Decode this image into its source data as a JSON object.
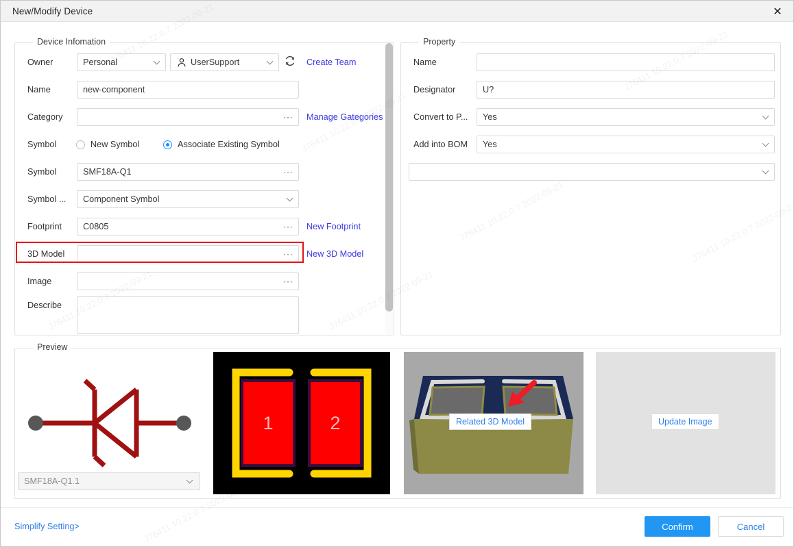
{
  "window": {
    "title": "New/Modify Device",
    "close_icon": "close-icon"
  },
  "device_information": {
    "legend": "Device Infomation",
    "owner": {
      "label": "Owner",
      "scope_value": "Personal",
      "team_value": "UserSupport",
      "team_icon": "person-icon",
      "refresh_icon": "refresh-icon",
      "create_team_link": "Create Team"
    },
    "name": {
      "label": "Name",
      "value": "new-component"
    },
    "category": {
      "label": "Category",
      "value": "",
      "browse_icon": "ellipsis-icon",
      "link": "Manage Gategories"
    },
    "symbol_mode": {
      "label": "Symbol",
      "option_new": "New Symbol",
      "option_existing": "Associate Existing Symbol",
      "selected": "Associate Existing Symbol"
    },
    "symbol": {
      "label": "Symbol",
      "value": "SMF18A-Q1",
      "browse_icon": "ellipsis-icon"
    },
    "symbol_type": {
      "label": "Symbol ...",
      "value": "Component Symbol"
    },
    "footprint": {
      "label": "Footprint",
      "value": "C0805",
      "browse_icon": "ellipsis-icon",
      "link": "New Footprint"
    },
    "model_3d": {
      "label": "3D Model",
      "value": "",
      "browse_icon": "ellipsis-icon",
      "link": "New 3D Model",
      "highlighted": true
    },
    "image": {
      "label": "Image",
      "value": "",
      "browse_icon": "ellipsis-icon"
    },
    "describe": {
      "label": "Describe",
      "value": ""
    }
  },
  "property": {
    "legend": "Property",
    "name": {
      "label": "Name",
      "value": ""
    },
    "designator": {
      "label": "Designator",
      "value": "U?"
    },
    "convert_to_pcb": {
      "label": "Convert to P...",
      "value": "Yes"
    },
    "add_into_bom": {
      "label": "Add into BOM",
      "value": "Yes"
    },
    "extra": {
      "value": ""
    }
  },
  "preview": {
    "legend": "Preview",
    "symbol_select_value": "SMF18A-Q1.1",
    "footprint_pads": [
      "1",
      "2"
    ],
    "related_3d_model_button": "Related 3D Model",
    "update_image_button": "Update Image"
  },
  "footer": {
    "simplify_setting": "Simplify Setting>",
    "confirm": "Confirm",
    "cancel": "Cancel"
  },
  "watermark": {
    "text": "J76411  10.22.0.7  2022-09-21"
  },
  "colors": {
    "accent": "#2196f3",
    "link": "#3a3ae0",
    "highlight": "#e8110f",
    "symbol_red": "#a01111",
    "pad_red": "#fe0000",
    "silk_yellow": "#ffd400",
    "pcb_navy": "#1b2a55",
    "pcb_olive": "#8c8a46"
  }
}
